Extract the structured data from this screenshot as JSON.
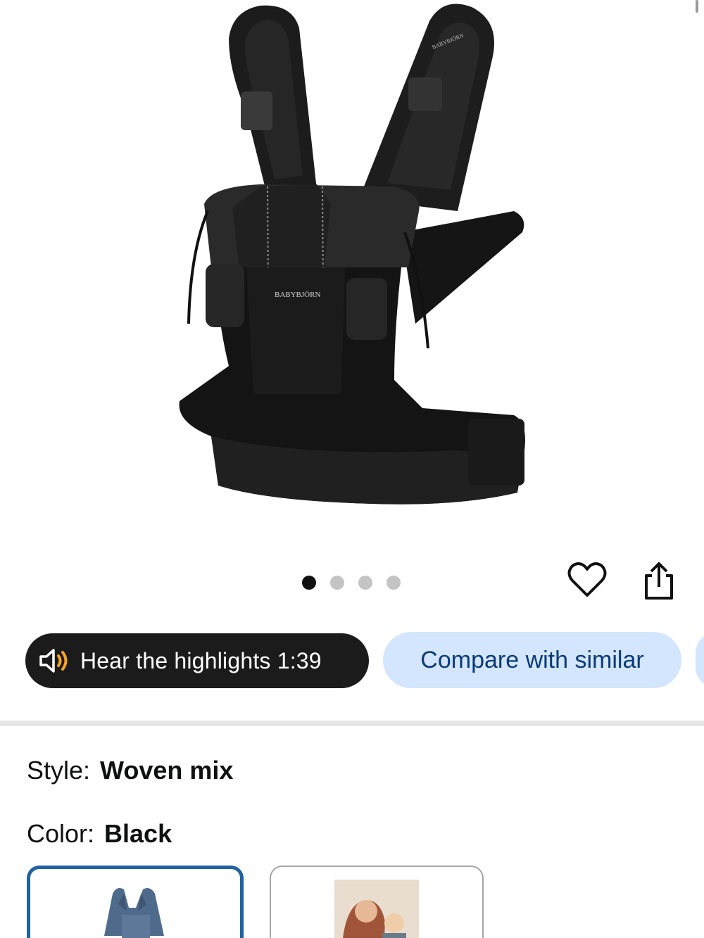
{
  "gallery": {
    "image_alt": "BabyBjorn baby carrier in black woven mix",
    "brand_mark": "BABYBJÖRN",
    "dots_count": 4,
    "active_dot": 1
  },
  "actions": {
    "favorite_icon": "heart-icon",
    "share_icon": "share-icon"
  },
  "pills": {
    "audio_label": "Hear the highlights 1:39",
    "audio_icon": "speaker-icon",
    "compare_label": "Compare with similar"
  },
  "variants": {
    "style_label": "Style:",
    "style_value": "Woven mix",
    "color_label": "Color:",
    "color_value": "Black"
  },
  "colors": {
    "audio_pill_bg": "#1b1b1b",
    "compare_pill_bg": "#d3e6fd",
    "compare_text": "#0b3a78",
    "selected_border": "#2162a1",
    "speaker_accent": "#f5a623"
  }
}
